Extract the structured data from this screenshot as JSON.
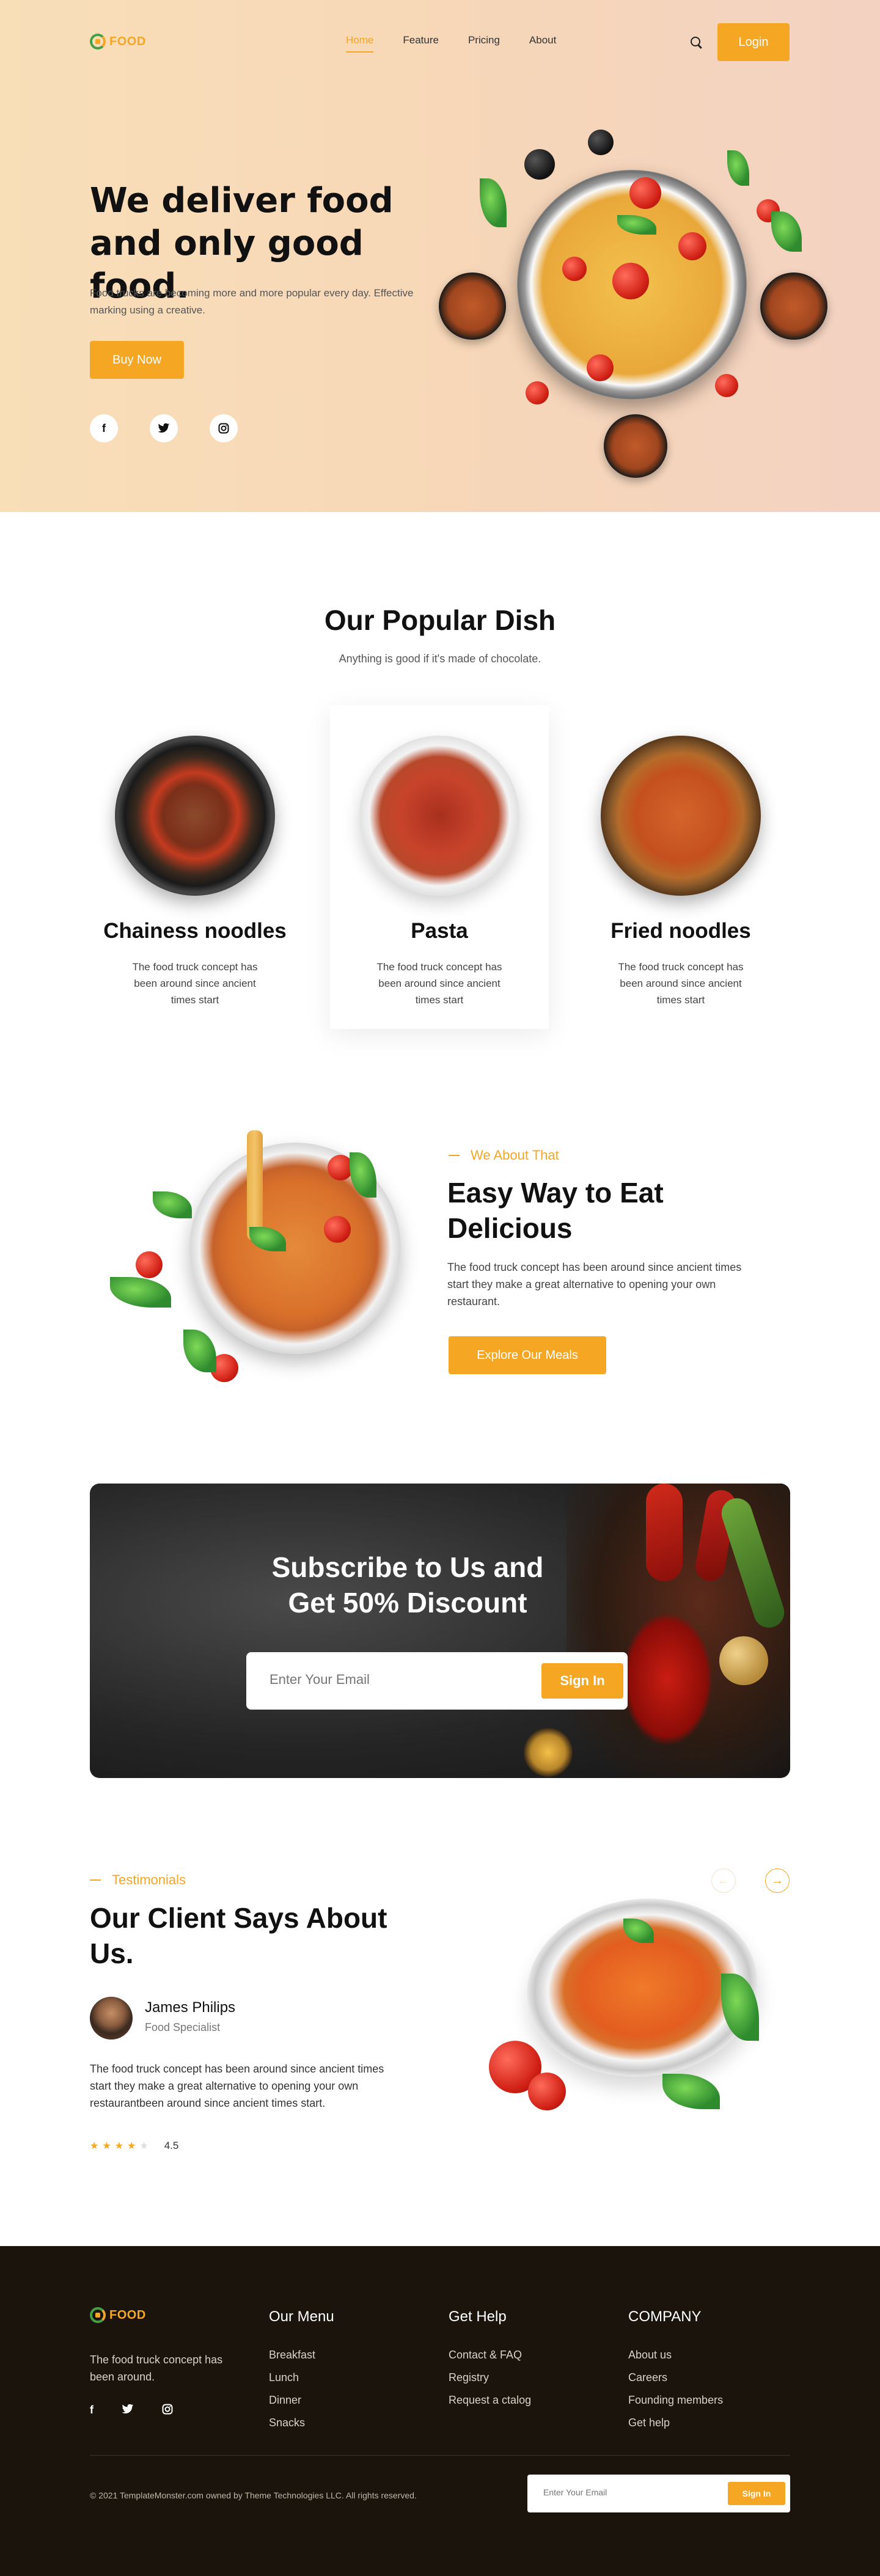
{
  "brand": {
    "name": "FOOD",
    "color": "#f5a623",
    "accent_green": "#43a047"
  },
  "nav": {
    "items": [
      "Home",
      "Feature",
      "Pricing",
      "About"
    ],
    "active": "Home",
    "search_icon": "search-icon",
    "login_label": "Login"
  },
  "hero": {
    "title": "We deliver food and only good food.",
    "description": "Food trucks are becoming more and more popular every day. Effective marking using a creative.",
    "cta_label": "Buy Now",
    "social": [
      "f",
      "t",
      "ig"
    ]
  },
  "popular": {
    "title": "Our Popular Dish",
    "subtitle": "Anything is good if it's made of chocolate.",
    "dishes": [
      {
        "name": "Chainess noodles",
        "description": "The food truck concept has been around since ancient times  start"
      },
      {
        "name": "Pasta",
        "description": "The food truck concept has been around since ancient times  start"
      },
      {
        "name": "Fried noodles",
        "description": "The food truck concept has been around since ancient times  start"
      }
    ]
  },
  "about": {
    "eyebrow": "We About That",
    "title": "Easy Way to Eat Delicious",
    "description": "The food truck concept has been around since ancient times  start they make a great alternative to opening your own restaurant.",
    "cta_label": "Explore Our Meals"
  },
  "subscribe": {
    "title": "Subscribe to Us and Get 50% Discount",
    "placeholder": "Enter Your Email",
    "button_label": "Sign In"
  },
  "testimonials": {
    "eyebrow": "Testimonials",
    "title": "Our Client Says About Us.",
    "person_name": "James Philips",
    "person_role": "Food Specialist",
    "quote": "The food truck concept has been around since ancient times  start they make a great alternative to opening your own restaurantbeen around since ancient times  start.",
    "rating": "4.5",
    "stars_filled": 4,
    "stars_total": 5,
    "prev_icon": "arrow-left-icon",
    "next_icon": "arrow-right-icon"
  },
  "footer": {
    "about": "The food truck concept has been around.",
    "columns": [
      {
        "title": "Our Menu",
        "items": [
          "Breakfast",
          "Lunch",
          "Dinner",
          "Snacks"
        ]
      },
      {
        "title": "Get Help",
        "items": [
          "Contact & FAQ",
          "Registry",
          "Request a ctalog"
        ]
      },
      {
        "title": "COMPANY",
        "items": [
          "About us",
          "Careers",
          "Founding members",
          "Get help"
        ]
      }
    ],
    "copyright": "© 2021 TemplateMonster.com owned by Theme Technologies LLC.  All rights reserved.",
    "email_placeholder": "Enter Your Email",
    "email_button": "Sign In"
  }
}
